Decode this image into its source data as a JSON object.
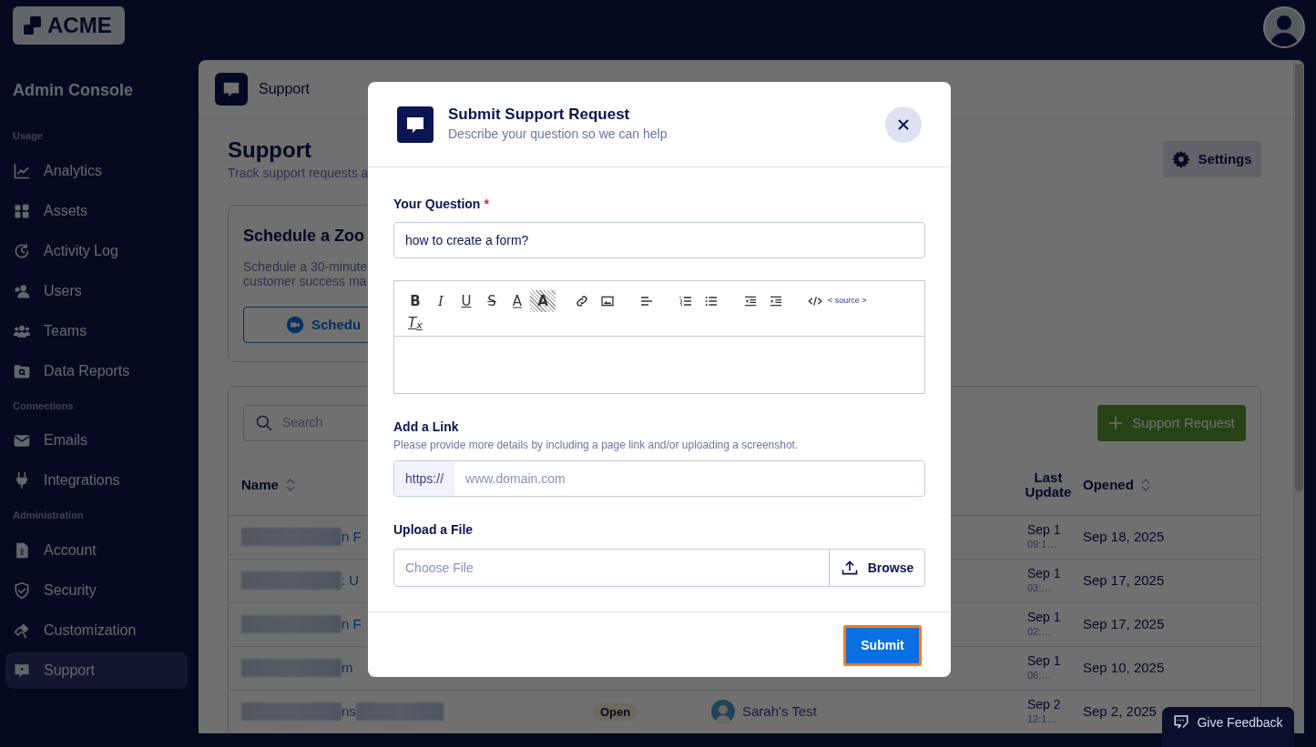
{
  "brand": {
    "logo_text": "ACME"
  },
  "sidebar": {
    "title": "Admin Console",
    "sections": [
      {
        "label": "Usage",
        "items": [
          {
            "label": "Analytics",
            "selected": false
          },
          {
            "label": "Assets",
            "selected": false
          },
          {
            "label": "Activity Log",
            "selected": false
          },
          {
            "label": "Users",
            "selected": false
          },
          {
            "label": "Teams",
            "selected": false
          },
          {
            "label": "Data Reports",
            "selected": false
          }
        ]
      },
      {
        "label": "Connections",
        "items": [
          {
            "label": "Emails",
            "selected": false
          },
          {
            "label": "Integrations",
            "selected": false
          }
        ]
      },
      {
        "label": "Administration",
        "items": [
          {
            "label": "Account",
            "selected": false
          },
          {
            "label": "Security",
            "selected": false
          },
          {
            "label": "Customization",
            "selected": false
          },
          {
            "label": "Support",
            "selected": true
          }
        ]
      }
    ]
  },
  "topbar": {
    "title": "Support"
  },
  "page": {
    "title": "Support",
    "subtitle": "Track support requests a",
    "settings_button": "Settings"
  },
  "zoom_card": {
    "title": "Schedule a Zoo",
    "description_lines": [
      "Schedule a 30-minute",
      "customer success ma"
    ],
    "button": "Schedu"
  },
  "requests": {
    "search_placeholder": "Search",
    "add_button": "Support Request",
    "columns": [
      {
        "label": "Name",
        "sortable": true
      },
      {
        "label": "Last Update",
        "sortable": false
      },
      {
        "label": "Opened",
        "sortable": true
      }
    ],
    "rows": [
      {
        "name_fragment": "n F",
        "redacted_tail": false,
        "last_update": "Sep 1",
        "last_update_time": "09:1…",
        "opened": "Sep 18, 2025"
      },
      {
        "name_fragment": ": U",
        "redacted_tail": false,
        "last_update": "Sep 1",
        "last_update_time": "03:…",
        "opened": "Sep 17, 2025"
      },
      {
        "name_fragment": "n F",
        "redacted_tail": false,
        "last_update": "Sep 1",
        "last_update_time": "02:…",
        "opened": "Sep 17, 2025"
      },
      {
        "name_fragment": "m",
        "redacted_tail": false,
        "last_update": "Sep 1",
        "last_update_time": "06:…",
        "opened": "Sep 10, 2025"
      },
      {
        "name_fragment": "ns",
        "redacted_tail": true,
        "status": "Open",
        "owner": "Sarah's Test",
        "last_update": "Sep 2",
        "last_update_time": "12:1…",
        "opened": "Sep 2, 2025"
      }
    ]
  },
  "feedback_button": "Give Feedback",
  "modal": {
    "title": "Submit Support Request",
    "subtitle": "Describe your question so we can help",
    "question": {
      "label": "Your Question",
      "required_mark": "*",
      "value": "how to create a form?"
    },
    "toolbar_groups": [
      {
        "tools": [
          {
            "kind": "bold",
            "glyph": "B"
          },
          {
            "kind": "italic",
            "glyph": "I"
          },
          {
            "kind": "underline",
            "glyph": "U"
          },
          {
            "kind": "strike",
            "glyph": "S"
          },
          {
            "kind": "text-color",
            "glyph": "A"
          },
          {
            "kind": "highlight",
            "glyph": "A"
          }
        ]
      },
      {
        "tools": [
          {
            "kind": "link"
          },
          {
            "kind": "image"
          }
        ]
      },
      {
        "tools": [
          {
            "kind": "align"
          }
        ]
      },
      {
        "tools": [
          {
            "kind": "ordered-list"
          },
          {
            "kind": "bullet-list"
          }
        ]
      },
      {
        "tools": [
          {
            "kind": "outdent"
          },
          {
            "kind": "indent"
          }
        ]
      },
      {
        "tools": [
          {
            "kind": "code"
          },
          {
            "kind": "source",
            "glyph": "< source >"
          }
        ]
      },
      {
        "tools": [
          {
            "kind": "clear-format",
            "glyph": "T$_{x}$"
          }
        ]
      }
    ],
    "link": {
      "label": "Add a Link",
      "hint": "Please provide more details by including a page link and/or uploading a screenshot.",
      "prefix": "https://",
      "placeholder": "www.domain.com"
    },
    "upload": {
      "label": "Upload a File",
      "placeholder": "Choose File",
      "button": "Browse"
    },
    "submit": {
      "label": "Submit",
      "focused": true
    }
  }
}
